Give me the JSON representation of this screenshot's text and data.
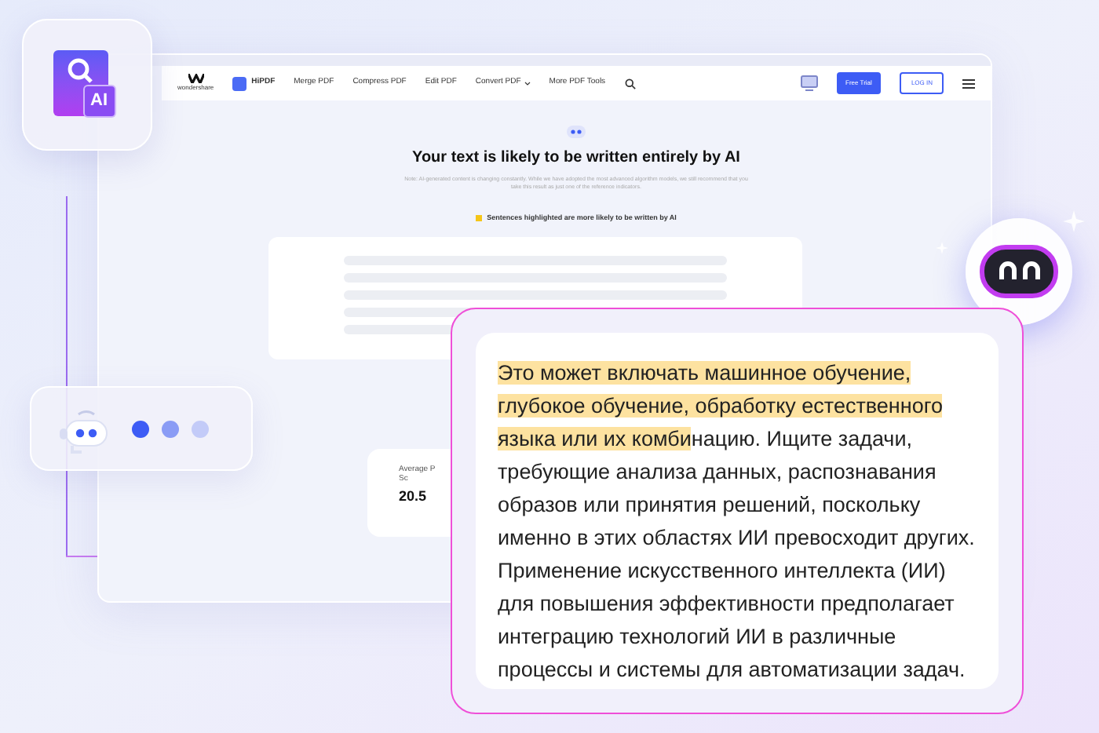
{
  "badge_icon": {
    "label": "AI"
  },
  "nav": {
    "logo": "wondershare",
    "product": "HiPDF",
    "links": [
      "Merge PDF",
      "Compress PDF",
      "Edit PDF",
      "Convert PDF",
      "More PDF Tools"
    ],
    "primary_button": "Free Trial",
    "login_button": "LOG IN"
  },
  "result": {
    "title": "Your text is likely to be written entirely by AI",
    "note": "Note: AI-generated content is changing constantly. While we have adopted the most advanced algorithm models, we still recommend that you take this result as just one of the reference indicators.",
    "legend": "Sentences highlighted are more likely to be written by AI"
  },
  "score_card": {
    "label_lines": [
      "Average P",
      "Sc"
    ],
    "value": "20.5"
  },
  "typing_indicator": {
    "dots": [
      {
        "color": "#3d5cf5"
      },
      {
        "color": "#8a9cf5"
      },
      {
        "color": "#c3cbf8"
      }
    ]
  },
  "excerpt": {
    "segments": [
      {
        "text": "Это может включать машинное обучение, глубокое обучение, обработку естественного языка или их комби",
        "highlighted": true
      },
      {
        "text": "нацию. Ищите задачи, требующие анализа данных, распознавания образов или принятия решений, поскольку именно в этих областях ИИ превосходит других. Применение искусственного интеллекта (ИИ) для повышения эффективности предполагает интеграцию технологий ИИ в различные процессы и системы для автоматизации задач.",
        "highlighted": false
      }
    ]
  }
}
